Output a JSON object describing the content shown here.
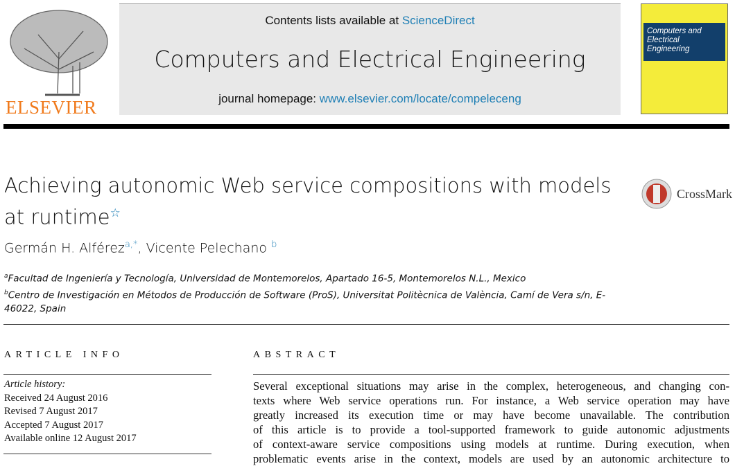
{
  "header": {
    "contents_prefix": "Contents lists available at ",
    "sciencedirect": "ScienceDirect",
    "journal": "Computers and Electrical Engineering",
    "homepage_prefix": "journal homepage: ",
    "homepage_url": "www.elsevier.com/locate/compeleceng",
    "publisher": "ELSEVIER"
  },
  "cover": {
    "title_line1": "Computers and",
    "title_line2": "Electrical Engineering"
  },
  "article": {
    "title": "Achieving autonomic Web service compositions with models at runtime",
    "title_note": "☆",
    "crossmark": "CrossMark",
    "authors": [
      {
        "name": "Germán H. Alférez",
        "sup": "a,*"
      },
      {
        "name": "Vicente Pelechano",
        "sup": "b"
      }
    ],
    "affiliations": [
      {
        "sup": "a",
        "text": "Facultad de Ingeniería y Tecnología, Universidad de Montemorelos, Apartado 16-5, Montemorelos N.L., Mexico"
      },
      {
        "sup": "b",
        "text": "Centro de Investigación en Métodos de Producción de Software (ProS), Universitat Politècnica de València, Camí de Vera s/n, E-46022, Spain"
      }
    ]
  },
  "info": {
    "heading": "ARTICLE INFO",
    "history_label": "Article history:",
    "history": [
      "Received 24 August 2016",
      "Revised 7 August 2017",
      "Accepted 7 August 2017",
      "Available online 12 August 2017"
    ]
  },
  "abstract": {
    "heading": "ABSTRACT",
    "lines": [
      "Several exceptional situations may arise in the complex, heterogeneous, and changing con-",
      "texts where Web service operations run. For instance, a Web service operation may have",
      "greatly increased its execution time or may have become unavailable. The contribution",
      "of this article is to provide a tool-supported framework to guide autonomic adjustments",
      "of context-aware service compositions using models at runtime. During execution, when",
      "problematic events arise in the context, models are used by an autonomic architecture to"
    ]
  },
  "colors": {
    "link": "#1f7fb5",
    "elsevier": "#f07a1c",
    "cover": "#f4ec3a",
    "cover_band": "#123f6b"
  }
}
